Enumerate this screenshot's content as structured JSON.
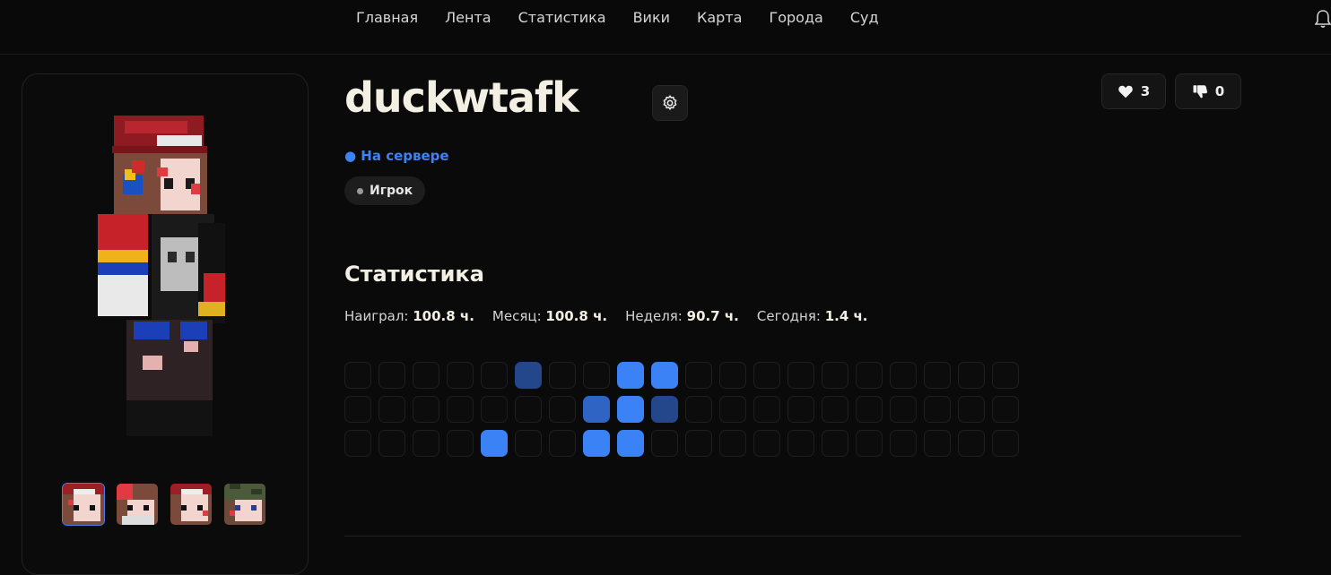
{
  "nav": {
    "items": [
      {
        "label": "Главная"
      },
      {
        "label": "Лента"
      },
      {
        "label": "Статистика"
      },
      {
        "label": "Вики"
      },
      {
        "label": "Карта"
      },
      {
        "label": "Города"
      },
      {
        "label": "Суд"
      }
    ],
    "bell_icon": "bell-icon"
  },
  "profile": {
    "username": "duckwtafk",
    "settings_icon": "gear-icon",
    "status": "● На сервере",
    "status_color": "#3e82f7",
    "role": "Игрок",
    "likes": "3",
    "dislikes": "0",
    "like_icon": "heart-icon",
    "dislike_icon": "thumbs-down-icon"
  },
  "skins": {
    "thumbnails": [
      "skin-1",
      "skin-2",
      "skin-3",
      "skin-4"
    ],
    "active_index": 0
  },
  "stats": {
    "title": "Статистика",
    "items": [
      {
        "label": "Наиграл:",
        "value": "100.8 ч."
      },
      {
        "label": "Месяц:",
        "value": "100.8 ч."
      },
      {
        "label": "Неделя:",
        "value": "90.7 ч."
      },
      {
        "label": "Сегодня:",
        "value": "1.4 ч."
      }
    ]
  },
  "activity": {
    "rows": 3,
    "cols": 20,
    "levels": [
      [
        0,
        0,
        0,
        0,
        0,
        1,
        0,
        0,
        3,
        3,
        0,
        0,
        0,
        0,
        0,
        0,
        0,
        0,
        0,
        0
      ],
      [
        0,
        0,
        0,
        0,
        0,
        0,
        0,
        2,
        3,
        1,
        0,
        0,
        0,
        0,
        0,
        0,
        0,
        0,
        0,
        0
      ],
      [
        0,
        0,
        0,
        0,
        3,
        0,
        0,
        3,
        3,
        0,
        0,
        0,
        0,
        0,
        0,
        0,
        0,
        0,
        0,
        0
      ]
    ],
    "colors": [
      "#0c0c0c",
      "#24478c",
      "#2f63c4",
      "#3b82f6"
    ]
  }
}
